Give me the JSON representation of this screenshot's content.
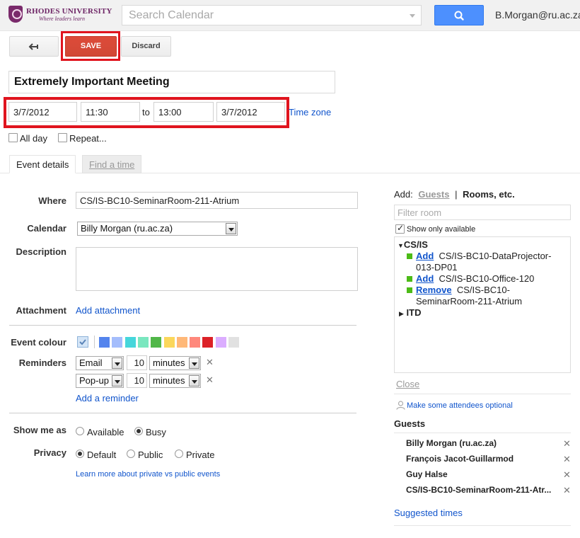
{
  "header": {
    "logo_name": "RHODES UNIVERSITY",
    "logo_tagline": "Where leaders learn",
    "search_placeholder": "Search Calendar",
    "account": "B.Morgan@ru.ac.za"
  },
  "toolbar": {
    "back_icon": "arrow-left-icon",
    "save_label": "SAVE",
    "discard_label": "Discard"
  },
  "event": {
    "title": "Extremely Important Meeting",
    "start_date": "3/7/2012",
    "start_time": "11:30",
    "to_label": "to",
    "end_time": "13:00",
    "end_date": "3/7/2012",
    "timezone_link": "Time zone",
    "all_day_label": "All day",
    "all_day_checked": false,
    "repeat_label": "Repeat...",
    "repeat_checked": false
  },
  "tabs": [
    {
      "label": "Event details",
      "active": true
    },
    {
      "label": "Find a time",
      "active": false
    }
  ],
  "details": {
    "where_label": "Where",
    "where_value": "CS/IS-BC10-SeminarRoom-211-Atrium",
    "calendar_label": "Calendar",
    "calendar_value": "Billy Morgan (ru.ac.za)",
    "description_label": "Description",
    "attachment_label": "Attachment",
    "add_attachment": "Add attachment",
    "colour_label": "Event colour",
    "colours": [
      "#5484ed",
      "#a4bdfc",
      "#46d6db",
      "#7ae7bf",
      "#51b749",
      "#fbd75b",
      "#ffb878",
      "#ff887c",
      "#dc2127",
      "#dbadff",
      "#e1e1e1"
    ],
    "reminders_label": "Reminders",
    "reminders": [
      {
        "type": "Email",
        "amount": "10",
        "unit": "minutes"
      },
      {
        "type": "Pop-up",
        "amount": "10",
        "unit": "minutes"
      }
    ],
    "add_reminder": "Add a reminder",
    "show_me_as_label": "Show me as",
    "available_label": "Available",
    "busy_label": "Busy",
    "show_me_as_value": "Busy",
    "privacy_label": "Privacy",
    "privacy_default": "Default",
    "privacy_public": "Public",
    "privacy_private": "Private",
    "privacy_value": "Default",
    "privacy_help": "Learn more about private vs public events"
  },
  "rooms": {
    "add_label": "Add:",
    "guests_tab": "Guests",
    "separator": "|",
    "rooms_tab": "Rooms, etc.",
    "filter_placeholder": "Filter room",
    "show_only_available": "Show only available",
    "show_only_available_checked": true,
    "group1": "CS/IS",
    "items": [
      {
        "action": "Add",
        "name_line1": "CS/IS-BC10-DataProjector-",
        "name_line2": "013-DP01"
      },
      {
        "action": "Add",
        "name_line1": "CS/IS-BC10-Office-120",
        "name_line2": ""
      },
      {
        "action": "Remove",
        "name_line1": "CS/IS-BC10-",
        "name_line2": "SeminarRoom-211-Atrium"
      }
    ],
    "group2": "ITD",
    "close_label": "Close",
    "optional_link": "Make some attendees optional"
  },
  "guests": {
    "heading": "Guests",
    "list": [
      "Billy Morgan (ru.ac.za)",
      "François Jacot-Guillarmod",
      "Guy Halse",
      "CS/IS-BC10-SeminarRoom-211-Atr..."
    ],
    "suggested": "Suggested times"
  }
}
